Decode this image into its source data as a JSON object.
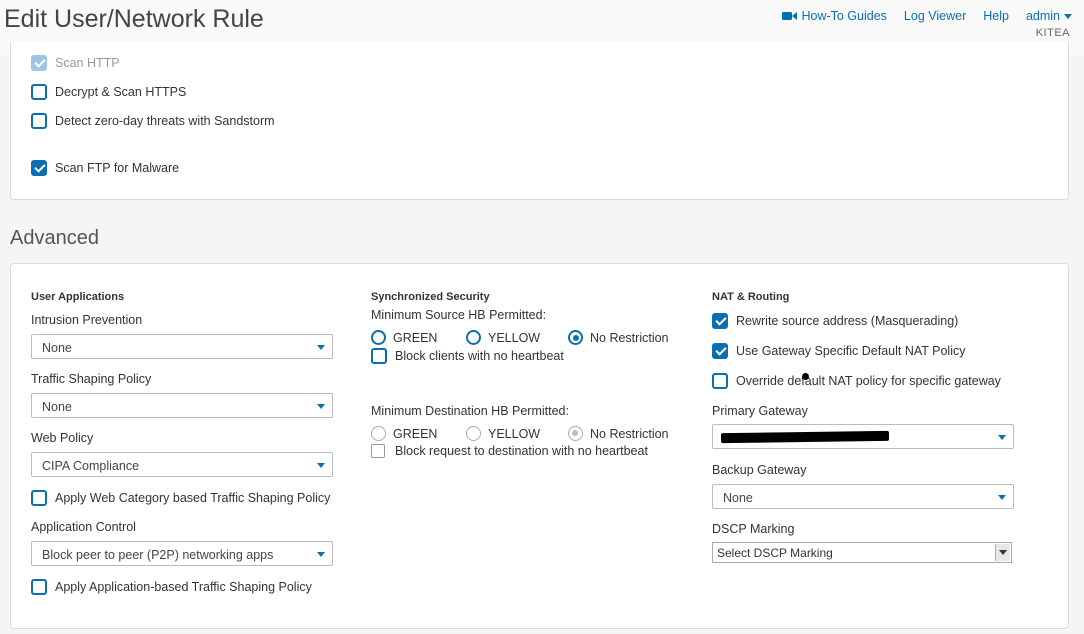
{
  "header": {
    "title": "Edit User/Network Rule",
    "nav": {
      "how_to": "How-To Guides",
      "log_viewer": "Log Viewer",
      "help": "Help",
      "user": "admin",
      "org": "KITEA"
    }
  },
  "scan": {
    "scan_http": {
      "label": "Scan HTTP",
      "checked": true,
      "disabled": true
    },
    "decrypt_https": {
      "label": "Decrypt & Scan HTTPS",
      "checked": false
    },
    "zero_day": {
      "label": "Detect zero-day threats with Sandstorm",
      "checked": false
    },
    "scan_ftp": {
      "label": "Scan FTP for Malware",
      "checked": true
    }
  },
  "advanced": {
    "title": "Advanced",
    "user_apps": {
      "heading": "User Applications",
      "ips_label": "Intrusion Prevention",
      "ips_value": "None",
      "tsp_label": "Traffic Shaping Policy",
      "tsp_value": "None",
      "web_label": "Web Policy",
      "web_value": "CIPA Compliance",
      "web_cat_ts": "Apply Web Category based Traffic Shaping Policy",
      "app_label": "Application Control",
      "app_value": "Block peer to peer (P2P) networking apps",
      "app_ts": "Apply Application-based Traffic Shaping Policy"
    },
    "sync_sec": {
      "heading": "Synchronized Security",
      "min_src_label": "Minimum Source HB Permitted:",
      "green": "GREEN",
      "yellow": "YELLOW",
      "no_restriction": "No Restriction",
      "block_clients": "Block clients with no heartbeat",
      "min_dst_label": "Minimum Destination HB Permitted:",
      "block_request": "Block request to destination with no heartbeat"
    },
    "nat": {
      "heading": "NAT & Routing",
      "rewrite": "Rewrite source address (Masquerading)",
      "gateway_nat": "Use Gateway Specific Default NAT Policy",
      "override": "Override default NAT policy for specific gateway",
      "primary_label": "Primary Gateway",
      "backup_label": "Backup Gateway",
      "backup_value": "None",
      "dscp_label": "DSCP Marking",
      "dscp_value": "Select DSCP Marking"
    }
  },
  "colors": {
    "accent": "#0a6fb1",
    "border": "#dcdcdc"
  }
}
